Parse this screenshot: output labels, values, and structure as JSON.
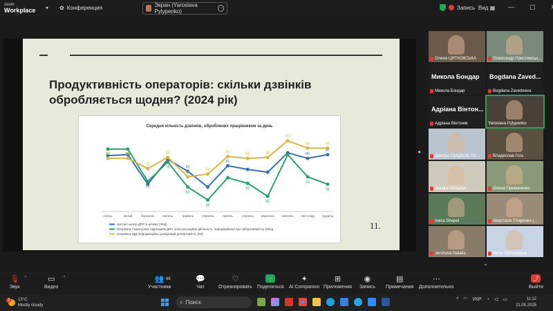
{
  "app": {
    "brand_top": "zoom",
    "brand_bottom": "Workplace"
  },
  "topbar": {
    "conference": "Конференция",
    "screen_share": "Экран (Yaroslava Pylypenko)",
    "record": "Запись",
    "view": "Вид",
    "accent_color": "#23a55a"
  },
  "slide": {
    "title": "Продуктивність операторів: скільки дзвінків обробляється щодня? (2024 рік)",
    "page_number": "11."
  },
  "chart_data": {
    "type": "line",
    "title": "Середня кількість дзвінків, оброблених працівником за день",
    "categories": [
      "січень",
      "лютий",
      "березень",
      "квітень",
      "травень",
      "червень",
      "липень",
      "серпень",
      "вересень",
      "жовтень",
      "листопад",
      "грудень"
    ],
    "series": [
      {
        "name": "Контакт-центр ДПС в цілому (ЗКЦ)",
        "color": "#3a6fb0",
        "values": [
          86,
          87,
          55,
          82,
          69,
          52,
          75,
          71,
          68,
          89,
          83,
          87
        ],
        "labels": [
          "",
          "",
          "",
          "",
          "",
          "",
          "",
          "",
          "",
          "",
          "",
          "87"
        ]
      },
      {
        "name": "Напрямок структурних підрозділів ДПС (консультаційна діяльність, інформування про заборгованість) (ЗКЦ)",
        "color": "#2e9e6e",
        "values": [
          93,
          93,
          58,
          79,
          52,
          38,
          62,
          56,
          42,
          87,
          63,
          55
        ]
      },
      {
        "name": "Напрямок ІДД (інформаційно-довідковий департамент) (КЗ)",
        "color": "#d6b84a",
        "values": [
          83,
          83,
          72,
          84,
          63,
          66,
          85,
          83,
          84,
          102,
          94,
          94
        ]
      }
    ],
    "point_labels": {
      "blue": [
        "",
        "",
        "",
        "",
        "63",
        "",
        "81",
        "",
        "",
        "",
        "85",
        "87"
      ],
      "green": [
        "93",
        "106",
        "58",
        "79",
        "52",
        "38",
        "",
        "56",
        "42",
        "",
        "63",
        "55"
      ],
      "gold": [
        "88",
        "88",
        "72",
        "84",
        "61",
        "66",
        "85",
        "83",
        "84",
        "102",
        "94",
        "94"
      ]
    },
    "ylim": [
      30,
      110
    ],
    "grid": false,
    "legend": "bottom"
  },
  "participants": [
    {
      "name": "Олена ЦЯТКОВСЬКА",
      "muted": true
    },
    {
      "name": "Олександр Пристемськ...",
      "muted": true
    },
    {
      "name": "Микола Бондар",
      "big": "Микола Бондар",
      "muted": true
    },
    {
      "name": "Bogdana Zavedeeva",
      "big": "Bogdana Zaved...",
      "muted": true
    },
    {
      "name": "Адріана Вінтоняк",
      "big": "Адріана Вінтон...",
      "muted": true
    },
    {
      "name": "Yaroslava Pylypenko",
      "muted": false,
      "active": true
    },
    {
      "name": "Дмитро ГЛАДКОВ По...",
      "muted": true
    },
    {
      "name": "Владислав Гога",
      "muted": true
    },
    {
      "name": "Nataliia Ostapiuk",
      "muted": true
    },
    {
      "name": "Олена Примаченко",
      "muted": true
    },
    {
      "name": "Inesa Shepel",
      "muted": true
    },
    {
      "name": "Анастасія Тітаренко (...",
      "muted": true
    },
    {
      "name": "Jershova Natalia",
      "muted": true
    },
    {
      "name": "Неля Проскурина",
      "muted": true
    }
  ],
  "toolbar": {
    "audio": "Звук",
    "video": "Видео",
    "participants": "Участники",
    "participants_count": "66",
    "chat": "Чат",
    "react": "Отреагировать",
    "share": "Поделиться",
    "ai": "AI Companion",
    "apps": "Приложения",
    "record": "Запись",
    "notes": "Примечания",
    "more": "Дополнительно",
    "leave": "Выйти"
  },
  "taskbar": {
    "temp": "13°C",
    "weather": "Mostly cloudy",
    "notif_count": "3",
    "search": "Поиск",
    "lang": "УКР",
    "time": "11:12",
    "date": "21.05.2025"
  }
}
